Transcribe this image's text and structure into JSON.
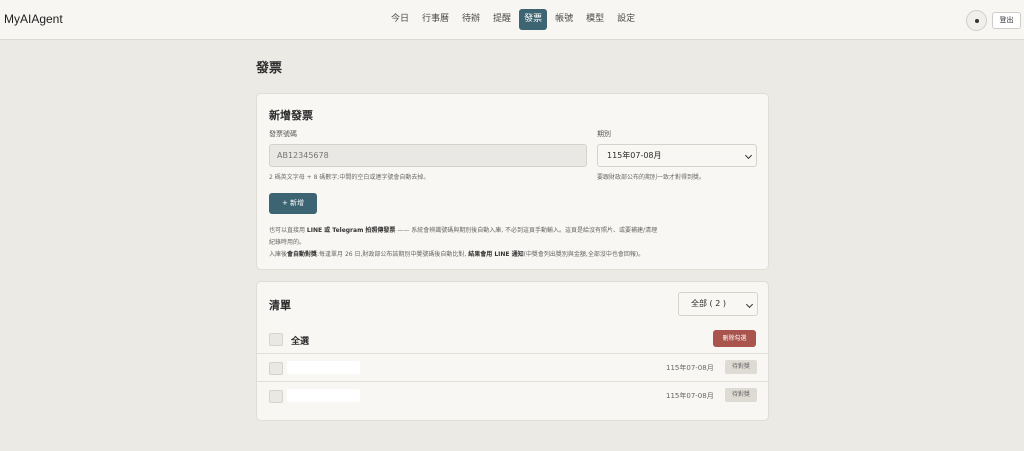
{
  "app": {
    "brand": "MyAIAgent",
    "logout": "登出"
  },
  "nav": {
    "items": [
      {
        "label": "今日",
        "active": false
      },
      {
        "label": "行事曆",
        "active": false
      },
      {
        "label": "待辦",
        "active": false
      },
      {
        "label": "提醒",
        "active": false
      },
      {
        "label": "發票",
        "active": true
      },
      {
        "label": "帳號",
        "active": false
      },
      {
        "label": "模型",
        "active": false
      },
      {
        "label": "設定",
        "active": false
      }
    ]
  },
  "page": {
    "title": "發票"
  },
  "new_invoice": {
    "title": "新增發票",
    "number_label": "發票號碼",
    "number_placeholder": "AB12345678",
    "number_hint": "2 碼英文字母 + 8 碼數字;中間的空白或連字號會自動去掉。",
    "period_label": "期別",
    "period_value": "115年07-08月",
    "period_hint": "要跟財政部公布的期別一致才對得到獎。",
    "add_button": "+ 新增",
    "note_line1_a": "也可以直接用 ",
    "note_line1_b": "LINE 或 Telegram 拍照傳發票",
    "note_line1_c": " —— 系統會辨識號碼與期別後自動入庫, 不必到這頁手動輸入。這頁是給沒有照片、或要補建/清理",
    "note_line2": "紀錄時用的。",
    "note_line3_a": "入庫後",
    "note_line3_b": "會自動對獎",
    "note_line3_c": ":每逢單月 26 日,財政部公布該期別中獎號碼後自動比對, ",
    "note_line3_d": "結果會用 LINE 通知",
    "note_line3_e": "(中獎會列出獎別與金額,全部沒中也會回報)。"
  },
  "list": {
    "title": "清單",
    "filter_value": "全部 ( 2 )",
    "select_all": "全選",
    "delete_button": "刪除勾選",
    "rows": [
      {
        "period": "115年07-08月",
        "status": "待對獎"
      },
      {
        "period": "115年07-08月",
        "status": "待對獎"
      }
    ]
  }
}
